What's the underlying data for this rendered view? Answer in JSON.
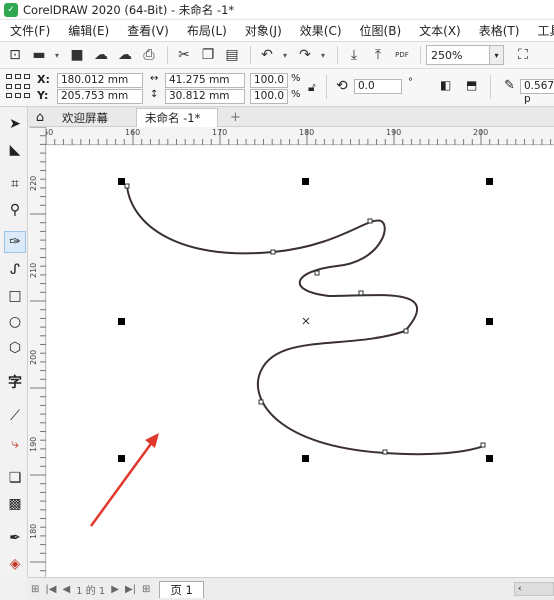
{
  "window": {
    "title": "CorelDRAW 2020 (64-Bit) - 未命名 -1*",
    "logo": "corel-logo"
  },
  "menu": [
    "文件(F)",
    "编辑(E)",
    "查看(V)",
    "布局(L)",
    "对象(J)",
    "效果(C)",
    "位图(B)",
    "文本(X)",
    "表格(T)",
    "工具"
  ],
  "toolbar": {
    "zoom": "250%",
    "pdf_label": "PDF"
  },
  "properties": {
    "x_label": "X:",
    "y_label": "Y:",
    "x_value": "180.012 mm",
    "y_value": "205.753 mm",
    "w_value": "41.275 mm",
    "h_value": "30.812 mm",
    "scale_w": "100.0",
    "scale_h": "100.0",
    "percent": "%",
    "rotation": "0.0",
    "degree": "°",
    "outline": "0.567 p"
  },
  "tabs": {
    "welcome": "欢迎屏幕",
    "document": "未命名 -1*",
    "add": "+"
  },
  "ruler": {
    "h_ticks": [
      "150",
      "160",
      "170",
      "180",
      "190",
      "200"
    ],
    "v_ticks": [
      "220",
      "210",
      "200",
      "190",
      "180"
    ]
  },
  "pages": {
    "counter": "1 的 1",
    "page_tab": "页 1"
  },
  "colors": {
    "canvas": "#ffffff",
    "curve": "#3a3030",
    "arrow": "#e0382c"
  }
}
